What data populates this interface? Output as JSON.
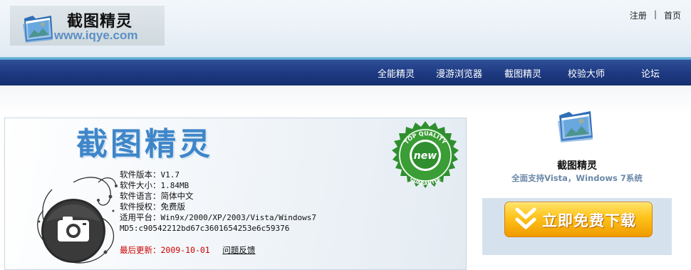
{
  "header": {
    "logo_title": "截图精灵",
    "logo_url": "www.iqye.com",
    "links": {
      "register": "注册",
      "separator": "|",
      "home": "首页"
    }
  },
  "nav": {
    "items": [
      "全能精灵",
      "漫游浏览器",
      "截图精灵",
      "校验大师",
      "论坛"
    ]
  },
  "banner": {
    "title": "截图精灵",
    "seal_top": "TOP QUALITY",
    "seal_center": "new",
    "seal_bottom": "GUARANTEE",
    "info": {
      "version_label": "软件版本：",
      "version": "V1.7",
      "size_label": "软件大小：",
      "size": "1.84MB",
      "language_label": "软件语言：",
      "language": "简体中文",
      "license_label": "软件授权：",
      "license": "免费版",
      "platform_label": "适用平台：",
      "platform": "Win9x/2000/XP/2003/Vista/Windows7",
      "md5": "MD5:c90542212bd67c3601654253e6c59376"
    },
    "last_update_label": "最后更新：",
    "last_update": "2009-10-01",
    "feedback_label": "问题反馈"
  },
  "sidebar": {
    "name": "截图精灵",
    "subtitle": "全面支持Vista，Windows 7系统",
    "download_label": "立即免费下载"
  },
  "colors": {
    "nav_bg": "#1e3a82",
    "title_blue": "#3f86c9",
    "seal_green": "#2f8f2f",
    "download_orange": "#ffc21a",
    "update_red": "#cc0000"
  },
  "icons": [
    "folder-photo-icon",
    "camera-icon",
    "quality-seal-icon",
    "download-arrow-icon"
  ]
}
